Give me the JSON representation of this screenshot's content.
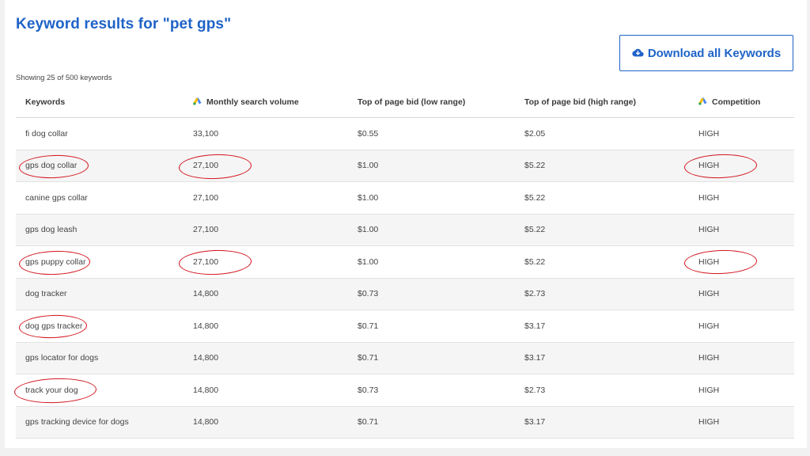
{
  "header": {
    "title": "Keyword results for \"pet gps\"",
    "download_label": "Download all Keywords",
    "showing_text": "Showing 25 of 500 keywords"
  },
  "table": {
    "columns": [
      "Keywords",
      "Monthly search volume",
      "Top of page bid (low range)",
      "Top of page bid (high range)",
      "Competition"
    ],
    "rows": [
      {
        "keyword": "fi dog collar",
        "volume": "33,100",
        "low": "$0.55",
        "high": "$2.05",
        "competition": "HIGH"
      },
      {
        "keyword": "gps dog collar",
        "volume": "27,100",
        "low": "$1.00",
        "high": "$5.22",
        "competition": "HIGH"
      },
      {
        "keyword": "canine gps collar",
        "volume": "27,100",
        "low": "$1.00",
        "high": "$5.22",
        "competition": "HIGH"
      },
      {
        "keyword": "gps dog leash",
        "volume": "27,100",
        "low": "$1.00",
        "high": "$5.22",
        "competition": "HIGH"
      },
      {
        "keyword": "gps puppy collar",
        "volume": "27,100",
        "low": "$1.00",
        "high": "$5.22",
        "competition": "HIGH"
      },
      {
        "keyword": "dog tracker",
        "volume": "14,800",
        "low": "$0.73",
        "high": "$2.73",
        "competition": "HIGH"
      },
      {
        "keyword": "dog gps tracker",
        "volume": "14,800",
        "low": "$0.71",
        "high": "$3.17",
        "competition": "HIGH"
      },
      {
        "keyword": "gps locator for dogs",
        "volume": "14,800",
        "low": "$0.71",
        "high": "$3.17",
        "competition": "HIGH"
      },
      {
        "keyword": "track your dog",
        "volume": "14,800",
        "low": "$0.73",
        "high": "$2.73",
        "competition": "HIGH"
      },
      {
        "keyword": "gps tracking device for dogs",
        "volume": "14,800",
        "low": "$0.71",
        "high": "$3.17",
        "competition": "HIGH"
      }
    ]
  },
  "colors": {
    "title_blue": "#1f63c8",
    "annotation_red": "#d2151d",
    "row_stripe": "#f5f5f5"
  },
  "icons": {
    "download": "cloud-download-icon",
    "google_ads": "google-ads-icon"
  }
}
